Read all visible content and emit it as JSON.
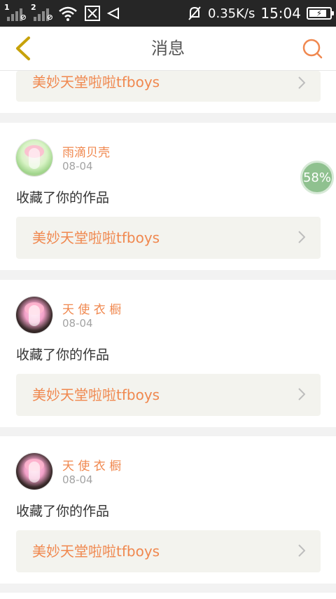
{
  "status_bar": {
    "sim1": "1",
    "sim2": "2",
    "speed": "0.35K/s",
    "time": "15:04",
    "battery_level": 0.85
  },
  "appbar": {
    "title": "消息"
  },
  "progress": {
    "label": "58%"
  },
  "messages": [
    {
      "work_title": "美妙天堂啦啦tfboys"
    },
    {
      "user": "雨滴贝壳",
      "date": "08-04",
      "action": "收藏了你的作品",
      "work_title": "美妙天堂啦啦tfboys"
    },
    {
      "user": "天 使 衣 橱",
      "date": "08-04",
      "action": "收藏了你的作品",
      "work_title": "美妙天堂啦啦tfboys"
    },
    {
      "user": "天 使 衣 橱",
      "date": "08-04",
      "action": "收藏了你的作品",
      "work_title": "美妙天堂啦啦tfboys"
    }
  ],
  "colors": {
    "accent": "#f0884f",
    "back_arrow": "#c7a20a",
    "progress": "#8fc18f"
  },
  "icons": {
    "back": "back-icon",
    "search": "search-icon",
    "chevron": "chevron-right-icon"
  }
}
